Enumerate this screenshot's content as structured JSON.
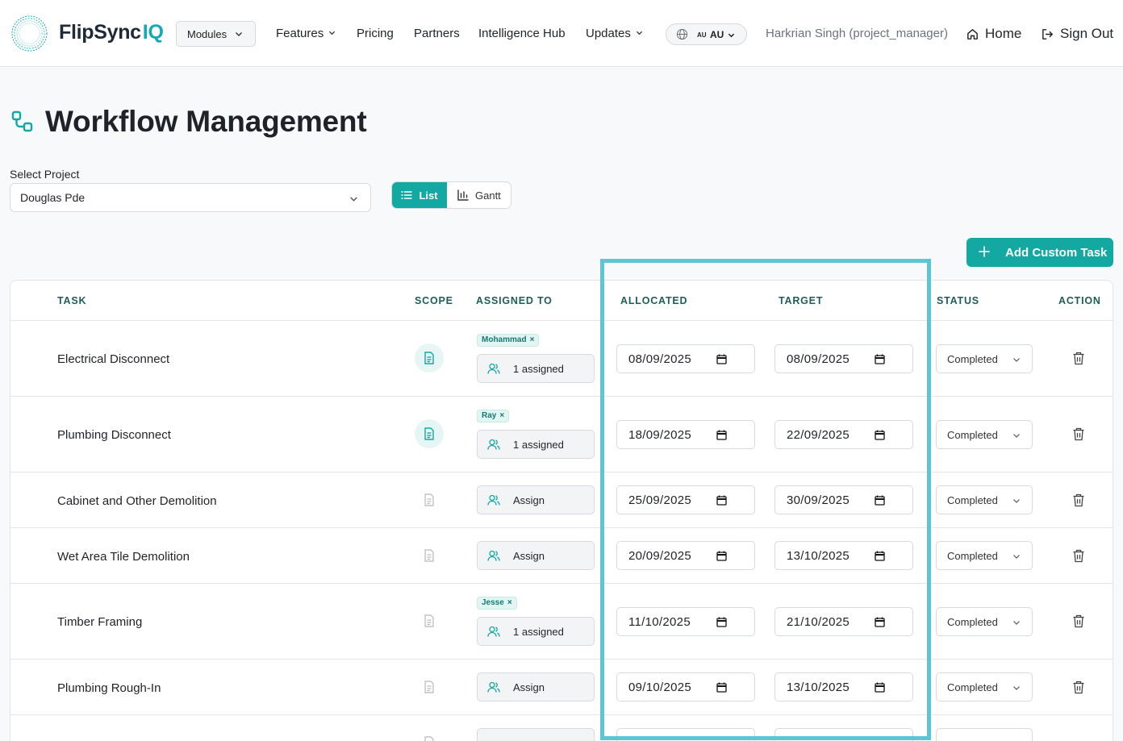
{
  "header": {
    "brand_name": "FlipSync",
    "brand_suffix": "IQ",
    "modules_label": "Modules",
    "nav": {
      "features": "Features",
      "pricing": "Pricing",
      "partners": "Partners",
      "intelligence_hub": "Intelligence Hub",
      "updates": "Updates"
    },
    "locale_flag": "AU",
    "locale_code": "AU",
    "user": "Harkrian Singh (project_manager)",
    "home": "Home",
    "sign_out": "Sign Out"
  },
  "page": {
    "title": "Workflow Management",
    "select_label": "Select Project",
    "selected_project": "Douglas Pde",
    "view_list": "List",
    "view_gantt": "Gantt",
    "add_task": "Add Custom Task"
  },
  "table": {
    "columns": {
      "task": "TASK",
      "scope": "SCOPE",
      "assigned": "ASSIGNED TO",
      "allocated": "ALLOCATED",
      "target": "TARGET",
      "status": "STATUS",
      "action": "ACTION"
    },
    "rows": [
      {
        "task": "Electrical Disconnect",
        "scope_active": true,
        "chip": "Mohammad",
        "assign": "1 assigned",
        "allocated": "08/09/2025",
        "target": "08/09/2025",
        "status": "Completed"
      },
      {
        "task": "Plumbing Disconnect",
        "scope_active": true,
        "chip": "Ray",
        "assign": "1 assigned",
        "allocated": "18/09/2025",
        "target": "22/09/2025",
        "status": "Completed"
      },
      {
        "task": "Cabinet and Other Demolition",
        "scope_active": false,
        "assign": "Assign",
        "allocated": "25/09/2025",
        "target": "30/09/2025",
        "status": "Completed"
      },
      {
        "task": "Wet Area Tile Demolition",
        "scope_active": false,
        "assign": "Assign",
        "allocated": "20/09/2025",
        "target": "13/10/2025",
        "status": "Completed"
      },
      {
        "task": "Timber Framing",
        "scope_active": false,
        "chip": "Jesse",
        "assign": "1 assigned",
        "allocated": "11/10/2025",
        "target": "21/10/2025",
        "status": "Completed"
      },
      {
        "task": "Plumbing Rough-In",
        "scope_active": false,
        "assign": "Assign",
        "allocated": "09/10/2025",
        "target": "13/10/2025",
        "status": "Completed"
      }
    ],
    "chip_remove_glyph": "×"
  },
  "colors": {
    "accent": "#13a9a2",
    "brand_iq": "#13a9b5",
    "header_text": "#1c5e58",
    "highlight": "#5fc4d6"
  }
}
